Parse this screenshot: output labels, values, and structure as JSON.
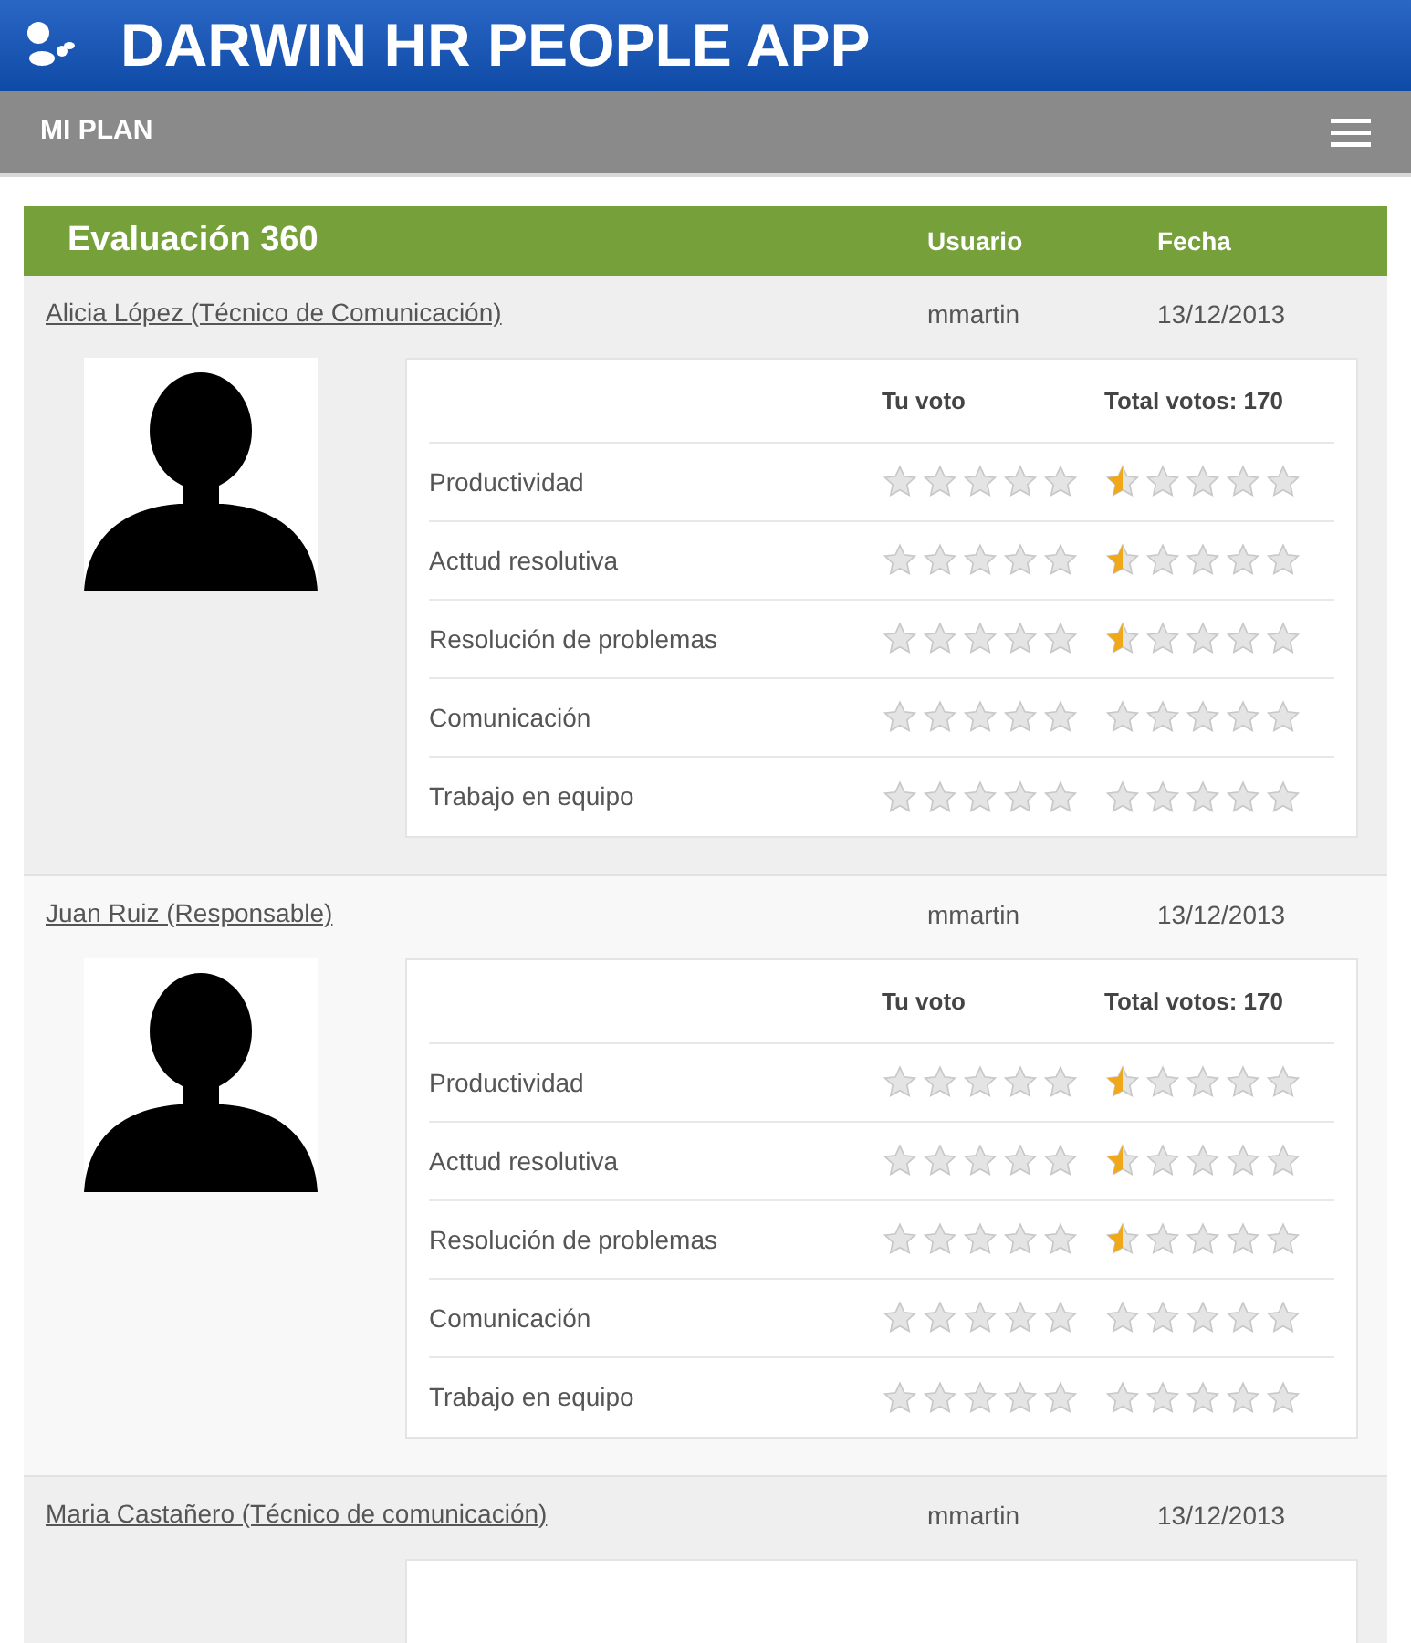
{
  "app_title": "DARWIN HR PEOPLE APP",
  "nav": {
    "title": "MI PLAN"
  },
  "table": {
    "title": "Evaluación 360",
    "columns": [
      "Usuario",
      "Fecha"
    ],
    "rows": [
      {
        "name": "Alicia López (Técnico de Comunicación)",
        "user": "mmartin",
        "date": "13/12/2013",
        "vote_header": "Tu voto",
        "total_header": "Total votos: 170",
        "criteria": [
          {
            "label": "Productividad",
            "my_vote": {
              "stars": 0
            },
            "total": {
              "stars": 0.5
            }
          },
          {
            "label": "Acttud resolutiva",
            "my_vote": {
              "stars": 0
            },
            "total": {
              "stars": 0.5
            }
          },
          {
            "label": "Resolución de problemas",
            "my_vote": {
              "stars": 0
            },
            "total": {
              "stars": 0.5
            }
          },
          {
            "label": "Comunicación",
            "my_vote": {
              "stars": 0
            },
            "total": {
              "stars": 0
            }
          },
          {
            "label": "Trabajo en equipo",
            "my_vote": {
              "stars": 0
            },
            "total": {
              "stars": 0
            }
          }
        ]
      },
      {
        "name": "Juan Ruiz (Responsable)",
        "user": "mmartin",
        "date": "13/12/2013",
        "vote_header": "Tu voto",
        "total_header": "Total votos: 170",
        "criteria": [
          {
            "label": "Productividad",
            "my_vote": {
              "stars": 0
            },
            "total": {
              "stars": 0.5
            }
          },
          {
            "label": "Acttud resolutiva",
            "my_vote": {
              "stars": 0
            },
            "total": {
              "stars": 0.5
            }
          },
          {
            "label": "Resolución de problemas",
            "my_vote": {
              "stars": 0
            },
            "total": {
              "stars": 0.5
            }
          },
          {
            "label": "Comunicación",
            "my_vote": {
              "stars": 0
            },
            "total": {
              "stars": 0
            }
          },
          {
            "label": "Trabajo en equipo",
            "my_vote": {
              "stars": 0
            },
            "total": {
              "stars": 0
            }
          }
        ]
      },
      {
        "name": "Maria Castañero (Técnico de comunicación)",
        "user": "mmartin",
        "date": "13/12/2013"
      }
    ]
  }
}
